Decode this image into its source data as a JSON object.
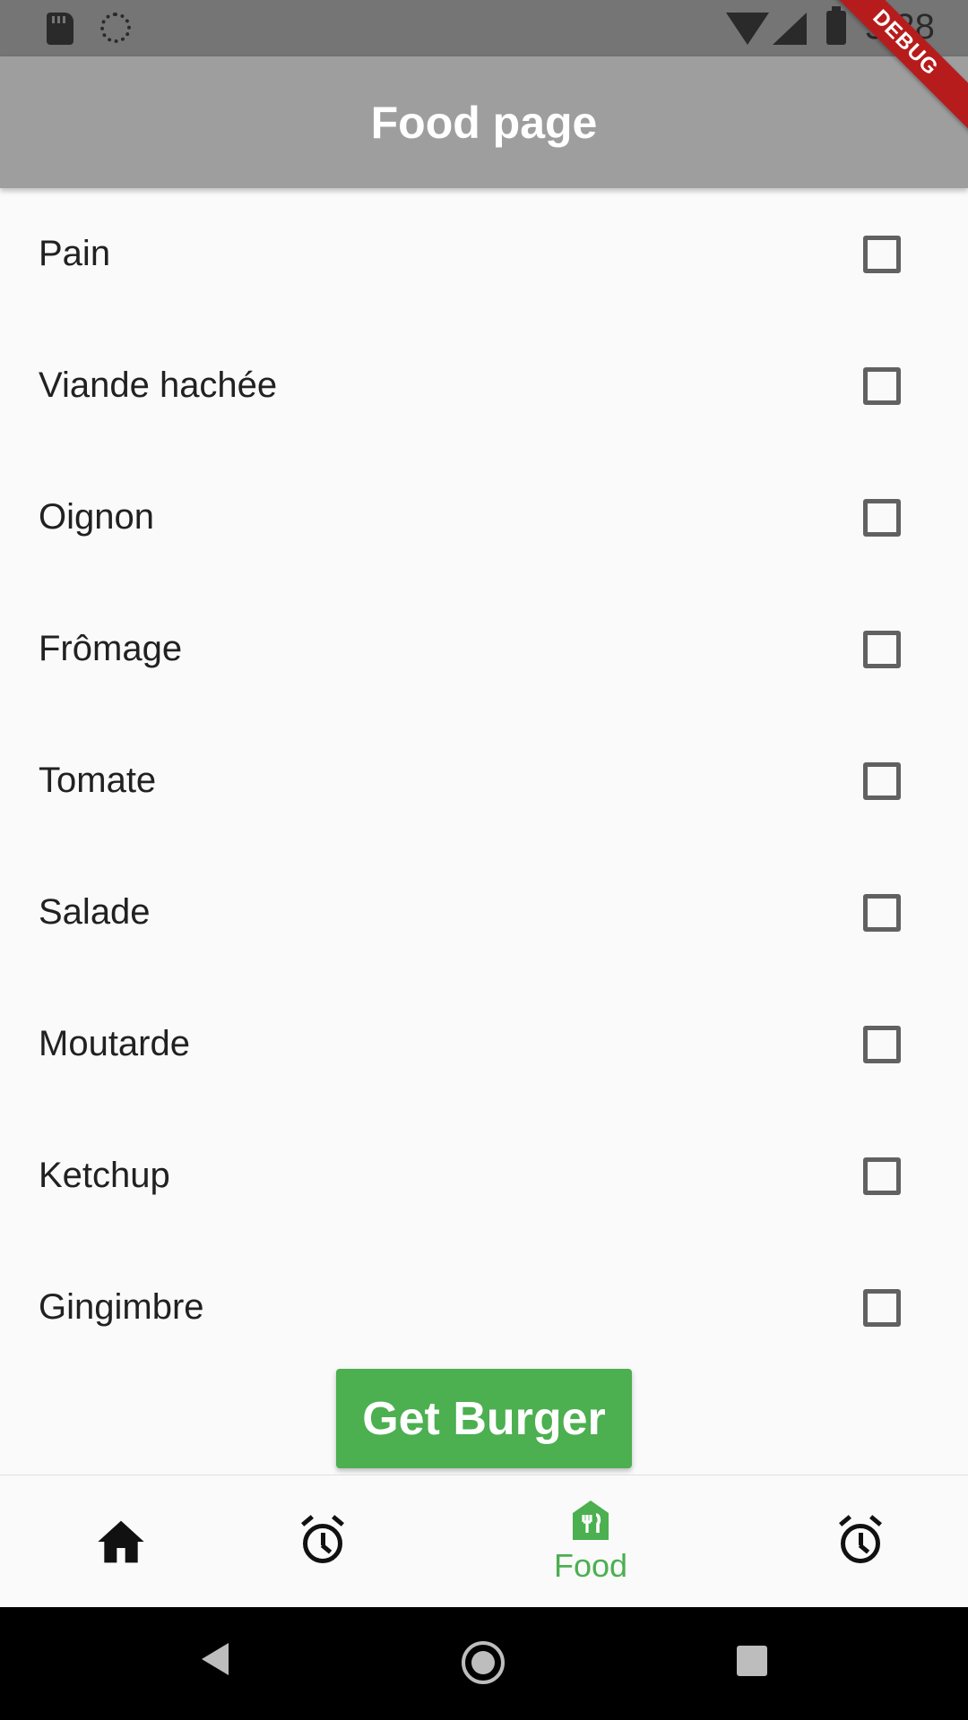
{
  "status_bar": {
    "time": "5:28",
    "icons": [
      "sd-card-icon",
      "sync-icon",
      "wifi-icon",
      "signal-icon",
      "battery-icon"
    ]
  },
  "app_bar": {
    "title": "Food page"
  },
  "debug_banner": {
    "label": "DEBUG"
  },
  "ingredients": [
    {
      "label": "Pain",
      "checked": false
    },
    {
      "label": "Viande hachée",
      "checked": false
    },
    {
      "label": "Oignon",
      "checked": false
    },
    {
      "label": "Frômage",
      "checked": false
    },
    {
      "label": "Tomate",
      "checked": false
    },
    {
      "label": "Salade",
      "checked": false
    },
    {
      "label": "Moutarde",
      "checked": false
    },
    {
      "label": "Ketchup",
      "checked": false
    },
    {
      "label": "Gingimbre",
      "checked": false
    }
  ],
  "action": {
    "get_burger_label": "Get Burger"
  },
  "bottom_nav": {
    "active_color": "#4caf50",
    "items": [
      {
        "icon": "home-icon",
        "label": ""
      },
      {
        "icon": "alarm-icon",
        "label": ""
      },
      {
        "icon": "restaurant-icon",
        "label": "Food"
      },
      {
        "icon": "alarm-icon",
        "label": ""
      }
    ]
  },
  "colors": {
    "app_bar": "#9e9e9e",
    "accent": "#4caf50",
    "debug_banner": "#b71c1c"
  }
}
